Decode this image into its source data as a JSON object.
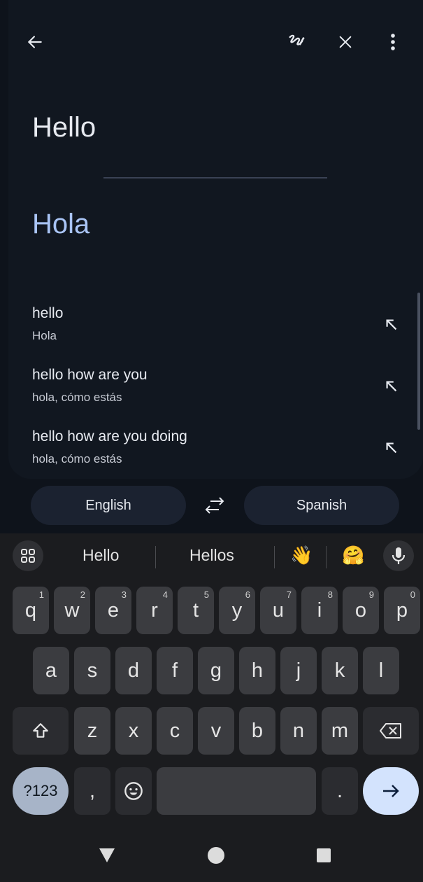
{
  "app": {
    "source_text": "Hello",
    "translation_text": "Hola",
    "suggestions": [
      {
        "source": "hello",
        "translation": "Hola"
      },
      {
        "source": "hello how are you",
        "translation": "hola, cómo estás"
      },
      {
        "source": "hello how are you doing",
        "translation": "hola, cómo estás"
      }
    ],
    "languages": {
      "source": "English",
      "target": "Spanish"
    }
  },
  "keyboard": {
    "suggestions": [
      "Hello",
      "Hellos",
      "👋",
      "🤗"
    ],
    "row1": [
      {
        "k": "q",
        "h": "1"
      },
      {
        "k": "w",
        "h": "2"
      },
      {
        "k": "e",
        "h": "3"
      },
      {
        "k": "r",
        "h": "4"
      },
      {
        "k": "t",
        "h": "5"
      },
      {
        "k": "y",
        "h": "6"
      },
      {
        "k": "u",
        "h": "7"
      },
      {
        "k": "i",
        "h": "8"
      },
      {
        "k": "o",
        "h": "9"
      },
      {
        "k": "p",
        "h": "0"
      }
    ],
    "row2": [
      "a",
      "s",
      "d",
      "f",
      "g",
      "h",
      "j",
      "k",
      "l"
    ],
    "row3": [
      "z",
      "x",
      "c",
      "v",
      "b",
      "n",
      "m"
    ],
    "symbols_label": "?123",
    "comma": ",",
    "period": "."
  },
  "colors": {
    "background": "#0e131b",
    "card": "#111720",
    "accent_translation": "#a9c4f5",
    "enter_key": "#d3e3fd"
  }
}
